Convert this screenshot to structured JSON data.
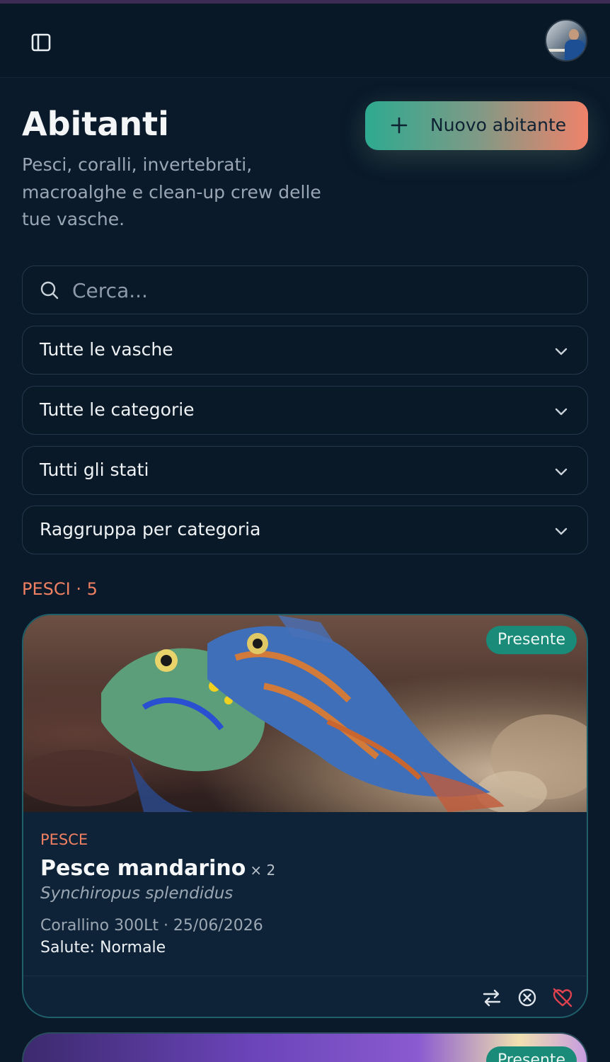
{
  "header": {
    "sidebar_toggle_icon": "sidebar-panel-icon",
    "avatar_alt": "user-avatar"
  },
  "page": {
    "title": "Abitanti",
    "subtitle": "Pesci, coralli, invertebrati, macroalghe e clean-up crew delle tue vasche.",
    "new_button_label": "Nuovo abitante"
  },
  "filters": {
    "search_placeholder": "Cerca...",
    "tank": "Tutte le vasche",
    "category": "Tutte le categorie",
    "status": "Tutti gli stati",
    "grouping": "Raggruppa per categoria"
  },
  "groups": [
    {
      "header": "PESCI · 5",
      "items": [
        {
          "status": "Presente",
          "category": "PESCE",
          "name": "Pesce mandarino",
          "quantity": "× 2",
          "scientific_name": "Synchiropus splendidus",
          "meta": "Corallino 300Lt · 25/06/2026",
          "health": "Salute: Normale",
          "actions": [
            "transfer-icon",
            "remove-circle-icon",
            "dead-heart-icon"
          ]
        },
        {
          "status": "Presente"
        }
      ]
    }
  ],
  "colors": {
    "background": "#0b1a2a",
    "accent_teal": "#2eaa90",
    "accent_coral": "#f0826a",
    "danger": "#e0414f"
  }
}
